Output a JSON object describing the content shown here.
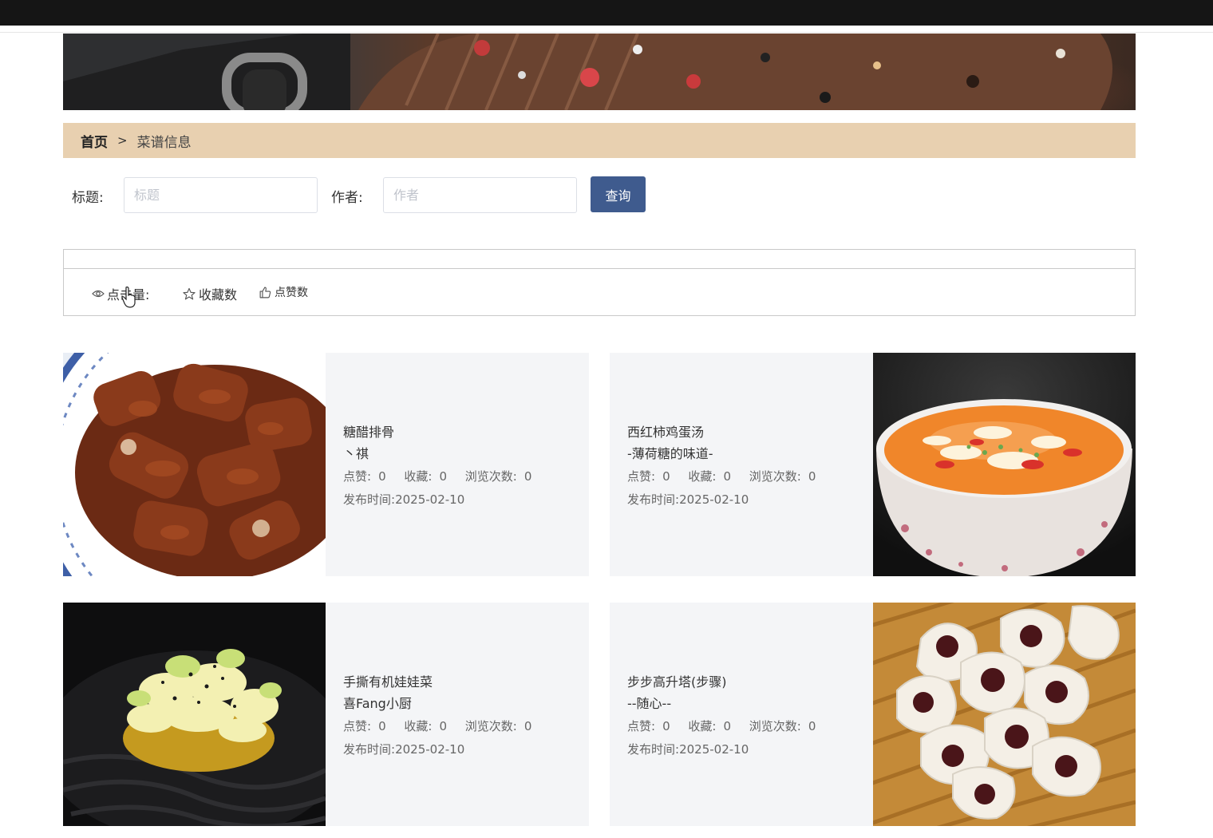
{
  "breadcrumb": {
    "home": "首页",
    "separator": ">",
    "current": "菜谱信息"
  },
  "search": {
    "title_label": "标题:",
    "title_placeholder": "标题",
    "author_label": "作者:",
    "author_placeholder": "作者",
    "button_label": "查询"
  },
  "sort": [
    {
      "label": "点击量:",
      "icon": "eye-icon"
    },
    {
      "label": "收藏数",
      "icon": "star-icon"
    },
    {
      "label": "点赞数",
      "icon": "thumbs-up-icon"
    }
  ],
  "recipes": [
    {
      "title": "糖醋排骨",
      "author": "丶祺",
      "likes_label": "点赞:",
      "likes": "0",
      "favorites_label": "收藏:",
      "favorites": "0",
      "views_label": "浏览次数:",
      "views": "0",
      "date_label": "发布时间:",
      "date": "2025-02-10",
      "image": "sweet-sour-ribs"
    },
    {
      "title": "西红柿鸡蛋汤",
      "author": "-薄荷糖的味道-",
      "likes_label": "点赞:",
      "likes": "0",
      "favorites_label": "收藏:",
      "favorites": "0",
      "views_label": "浏览次数:",
      "views": "0",
      "date_label": "发布时间:",
      "date": "2025-02-10",
      "image": "tomato-egg-soup"
    },
    {
      "title": "手撕有机娃娃菜",
      "author": "喜Fang小厨",
      "likes_label": "点赞:",
      "likes": "0",
      "favorites_label": "收藏:",
      "favorites": "0",
      "views_label": "浏览次数:",
      "views": "0",
      "date_label": "发布时间:",
      "date": "2025-02-10",
      "image": "baby-cabbage"
    },
    {
      "title": "步步高升塔(步骤)",
      "author": "--随心--",
      "likes_label": "点赞:",
      "likes": "0",
      "favorites_label": "收藏:",
      "favorites": "0",
      "views_label": "浏览次数:",
      "views": "0",
      "date_label": "发布时间:",
      "date": "2025-02-10",
      "image": "date-buns"
    }
  ],
  "colors": {
    "breadcrumb_bg": "#e8d0b0",
    "button_bg": "#3f5b8e",
    "card_bg": "#f4f5f7"
  }
}
